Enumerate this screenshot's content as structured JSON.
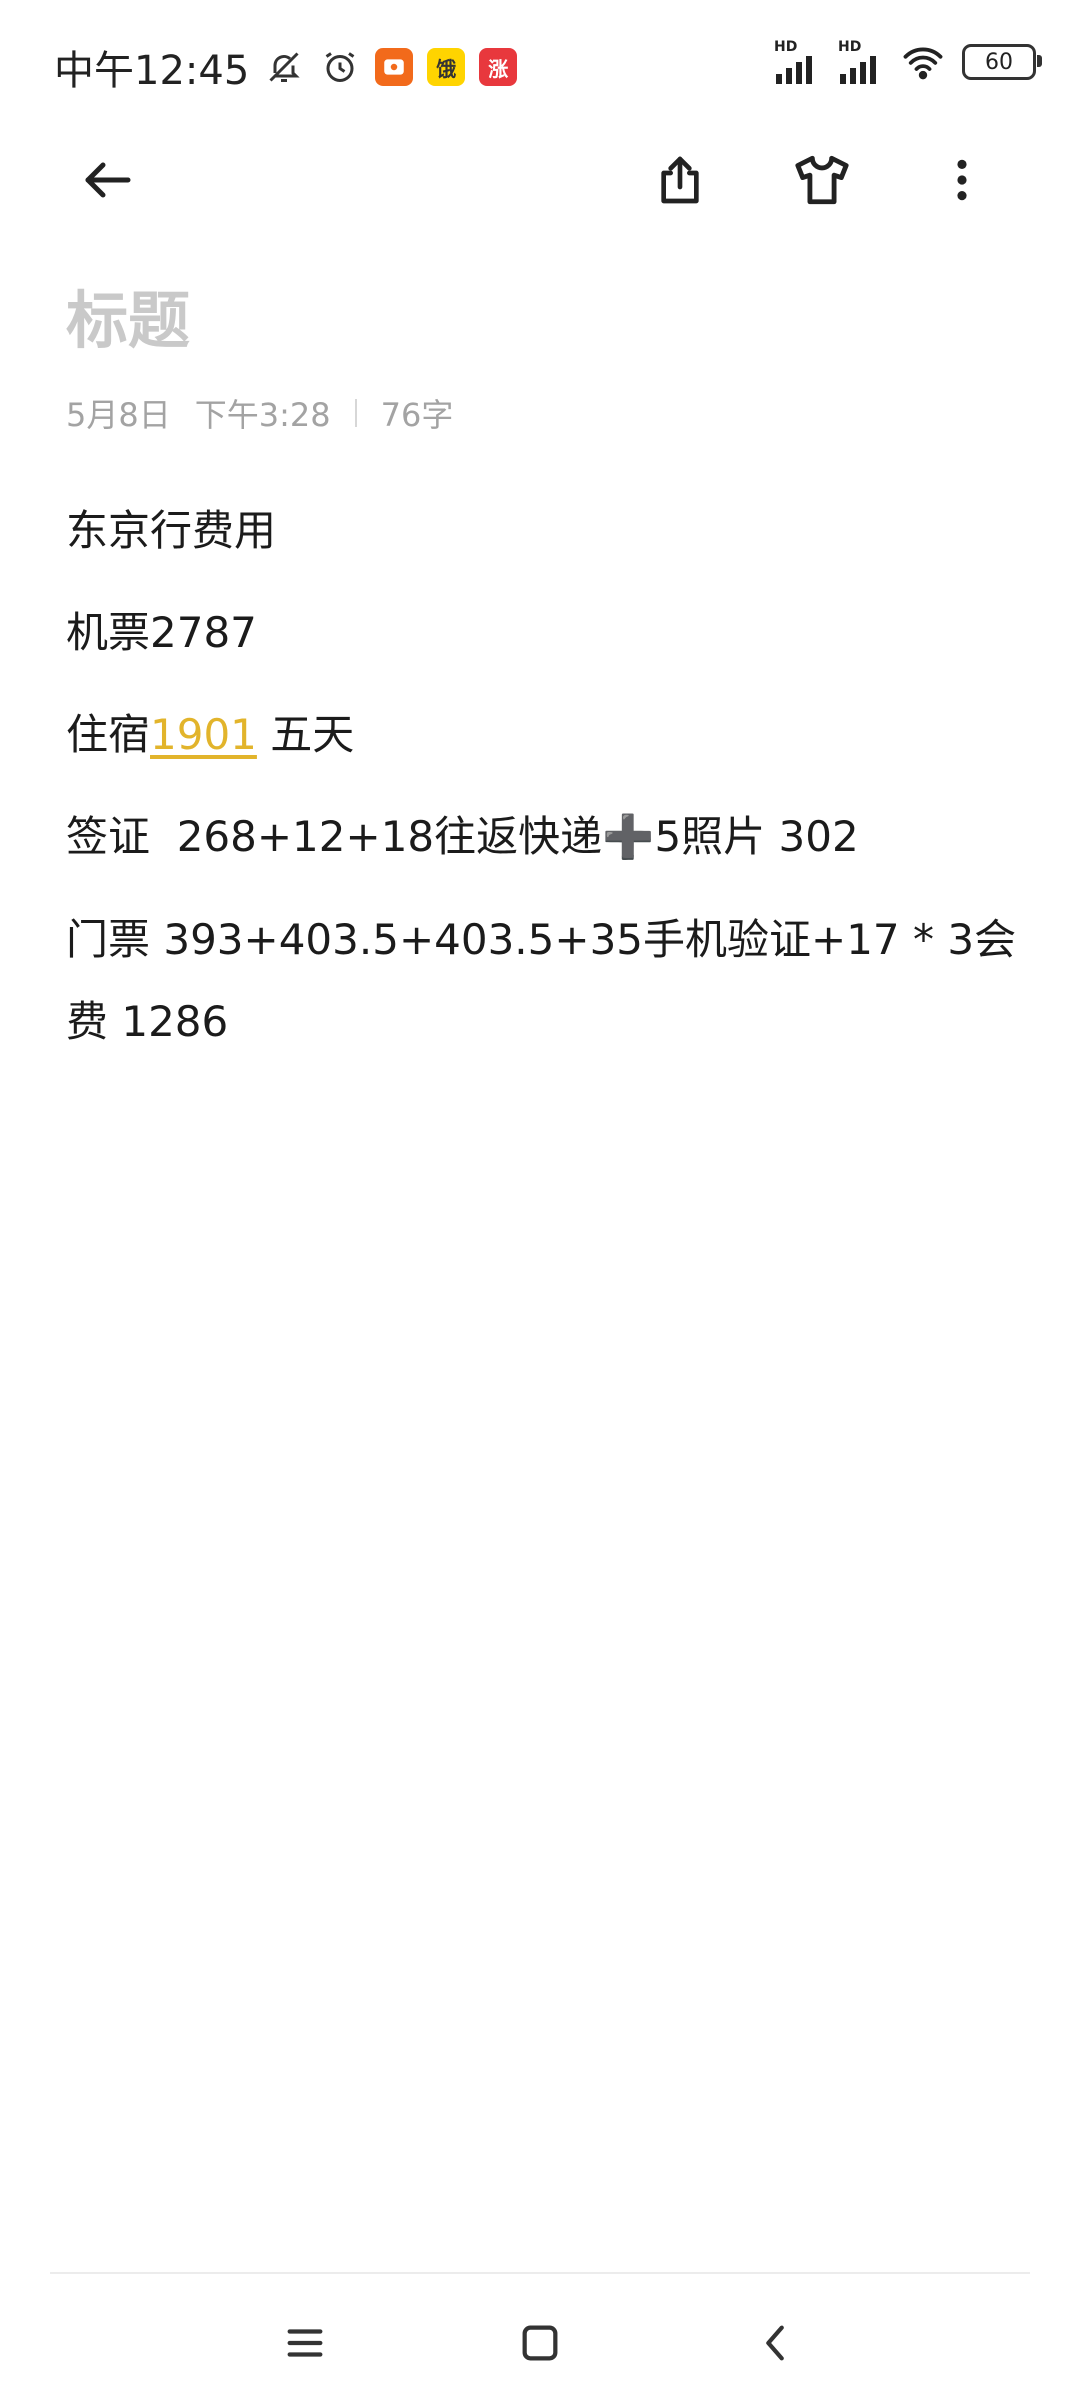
{
  "status_bar": {
    "time": "中午12:45",
    "battery": "60",
    "signal_label": "HD",
    "icons": [
      "bell-off-icon",
      "alarm-icon",
      "app-icon-orange",
      "app-icon-yellow",
      "app-icon-red",
      "signal-icon",
      "signal-icon",
      "wifi-icon",
      "battery-icon"
    ],
    "badge_yellow": "饿",
    "badge_red": "涨"
  },
  "toolbar": {
    "back": "back-arrow-icon",
    "share": "share-icon",
    "theme": "shirt-icon",
    "more": "more-vert-icon"
  },
  "note": {
    "title": "标题",
    "date": "5月8日",
    "time": "下午3:28",
    "word_count": "76字",
    "lines": {
      "l1": "东京行费用",
      "l2": "机票2787",
      "l3_a": "住宿",
      "l3_link": "1901",
      "l3_b": " 五天",
      "l4_a": "签证  268+12+18往返快递",
      "l4_plus": "➕",
      "l4_b": "5照片 302",
      "l5": "门票 393+403.5+403.5+35手机验证+17 * 3会费 1286"
    }
  },
  "colors": {
    "accent": "#e2b42b",
    "title_placeholder": "#c9c9c9",
    "meta": "#a3a3a3"
  }
}
